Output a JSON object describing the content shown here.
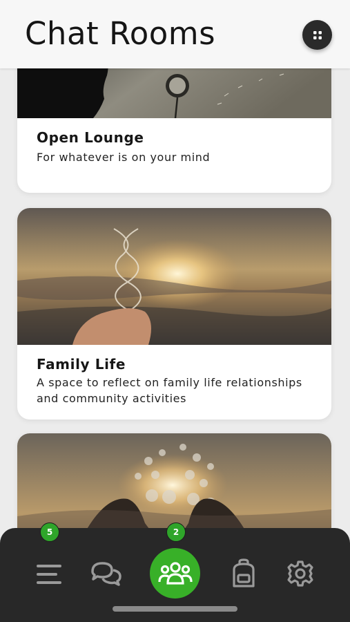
{
  "header": {
    "title": "Chat Rooms"
  },
  "rooms": [
    {
      "title": "Open Lounge",
      "description": "For whatever is on your mind"
    },
    {
      "title": "Family Life",
      "description": "A space to reflect on family life relationships and community activities"
    },
    {
      "title": "",
      "description": ""
    }
  ],
  "nav": {
    "menu_badge": "5",
    "rooms_badge": "2",
    "active_item": "chat-rooms",
    "accent_color": "#38b028"
  }
}
